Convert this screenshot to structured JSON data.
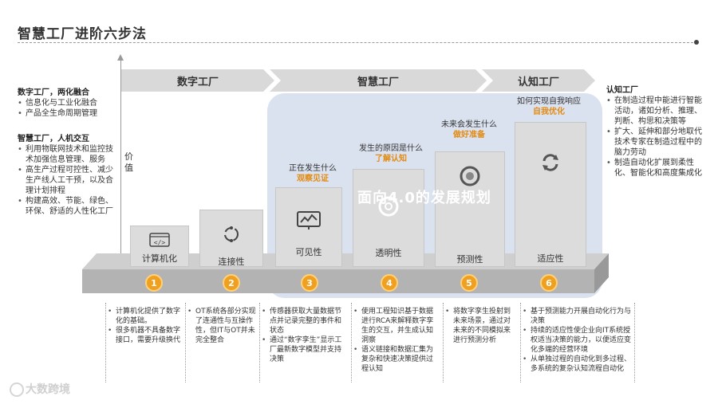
{
  "title": "智慧工厂进阶六步法",
  "axis_label": "价值",
  "stages": [
    {
      "label": "数字工厂"
    },
    {
      "label": "智慧工厂"
    },
    {
      "label": "认知工厂"
    }
  ],
  "overlay_text": "面向4.0的发展规划",
  "left_panel": {
    "block1": {
      "heading": "数字工厂，两化融合",
      "items": [
        "信息化与工业化融合",
        "产品全生命周期管理"
      ]
    },
    "block2": {
      "heading": "智慧工厂，人机交互",
      "items": [
        "利用物联网技术和监控技术加强信息管理、服务",
        "高生产过程可控性、减少生产线人工干预，以及合理计划排程",
        "构建高效、节能、绿色、环保、舒适的人性化工厂"
      ]
    }
  },
  "right_panel": {
    "heading": "认知工厂",
    "items": [
      "在制造过程中能进行智能活动，诸如分析、推理、判断、构思和决策等",
      "扩大、延伸和部分地取代技术专家在制造过程中的脑力劳动",
      "制造自动化扩展到柔性化、智能化和高度集成化"
    ]
  },
  "steps": [
    {
      "num": "1",
      "label": "计算机化",
      "icon": "code-icon"
    },
    {
      "num": "2",
      "label": "连接性",
      "icon": "connectivity-icon"
    },
    {
      "num": "3",
      "label": "可见性",
      "icon": "monitor-chart-icon",
      "question": "正在发生什么",
      "answer": "观察见证"
    },
    {
      "num": "4",
      "label": "透明性",
      "icon": "transparency-icon",
      "question": "发生的原因是什么",
      "answer": "了解认知"
    },
    {
      "num": "5",
      "label": "预测性",
      "icon": "predict-icon",
      "question": "未来会发生什么",
      "answer": "做好准备"
    },
    {
      "num": "6",
      "label": "适应性",
      "icon": "adapt-cycle-icon",
      "question": "如何实现自我响应",
      "answer": "自我优化"
    }
  ],
  "bottom_notes": [
    [
      "计算机化提供了数字化的基础。",
      "很多机器不具备数字接口，需要升级换代"
    ],
    [
      "OT系统各部分实现了连通性与互操作性，但IT与OT并未完全整合"
    ],
    [
      "传感器获取大量数据节点并记录完整的事件和状态",
      "通过“数字孪生”显示工厂最新数字模型并支持决策"
    ],
    [
      "使用工程知识基于数据进行RCA来解释数字孪生的交互，并生成认知洞察",
      "语义链接和数据汇集为复杂和快速决策提供过程认知"
    ],
    [
      "将数字孪生投射到未来场景，通过对未来的不同模拟来进行预测分析"
    ],
    [
      "基于预测能力开展自动化行为与决策",
      "持续的适应性使企业向IT系统授权适当决策的能力，以便适应变化多端的经营环境",
      "从单独过程的自动化到多过程、多系统的复杂认知流程自动化"
    ]
  ],
  "watermark": "大数跨境",
  "colors": {
    "accent": "#e38b12",
    "badge": "#f0a020",
    "highlight": "#96aad2"
  }
}
